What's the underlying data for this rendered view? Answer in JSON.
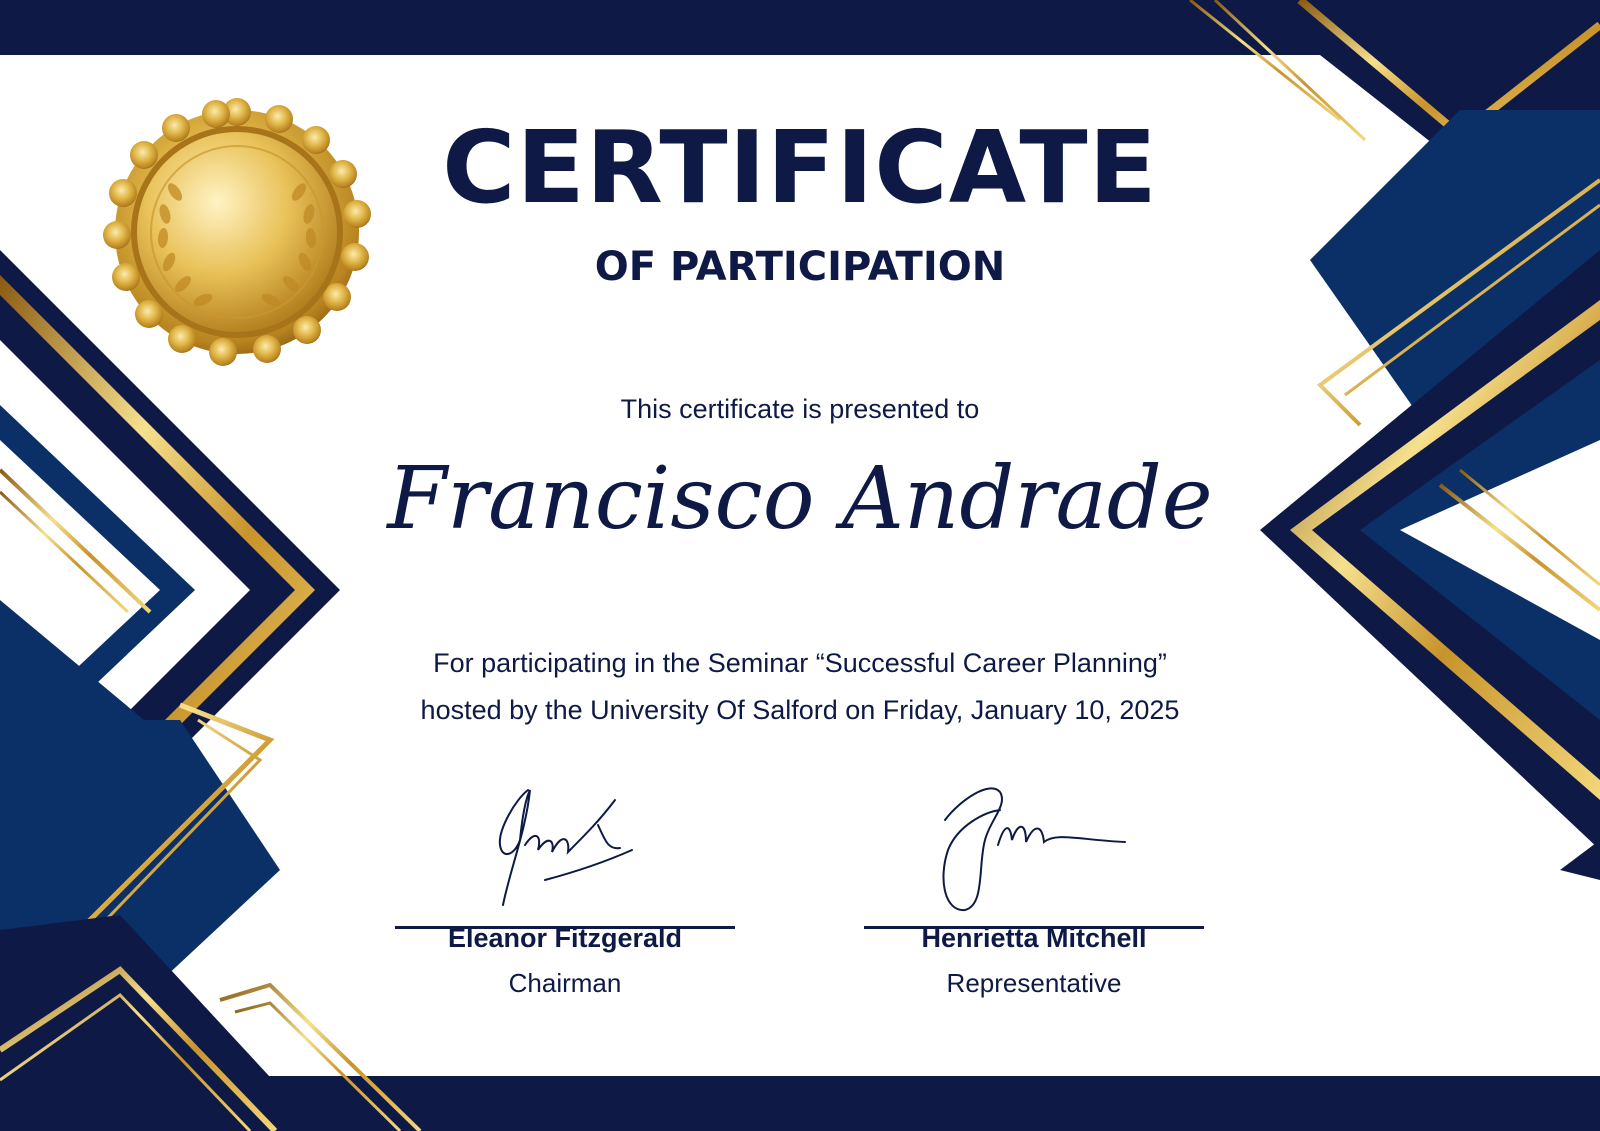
{
  "certificate": {
    "title": "CERTIFICATE",
    "subtitle": "OF PARTICIPATION",
    "presented_to_label": "This certificate is presented to",
    "recipient_name": "Francisco Andrade",
    "description_line1": "For participating in the Seminar “Successful Career Planning”",
    "description_line2": "hosted by the University Of Salford on Friday, January 10, 2025"
  },
  "signatories": [
    {
      "name": "Eleanor Fitzgerald",
      "role": "Chairman"
    },
    {
      "name": "Henrietta Mitchell",
      "role": "Representative"
    }
  ],
  "colors": {
    "navy": "#0e1a45",
    "blue": "#0b3068",
    "gold": "#d4a83a",
    "gold_light": "#f3dc86",
    "background": "#ffffff"
  },
  "icons": {
    "seal": "gold-seal-with-laurel-icon"
  }
}
